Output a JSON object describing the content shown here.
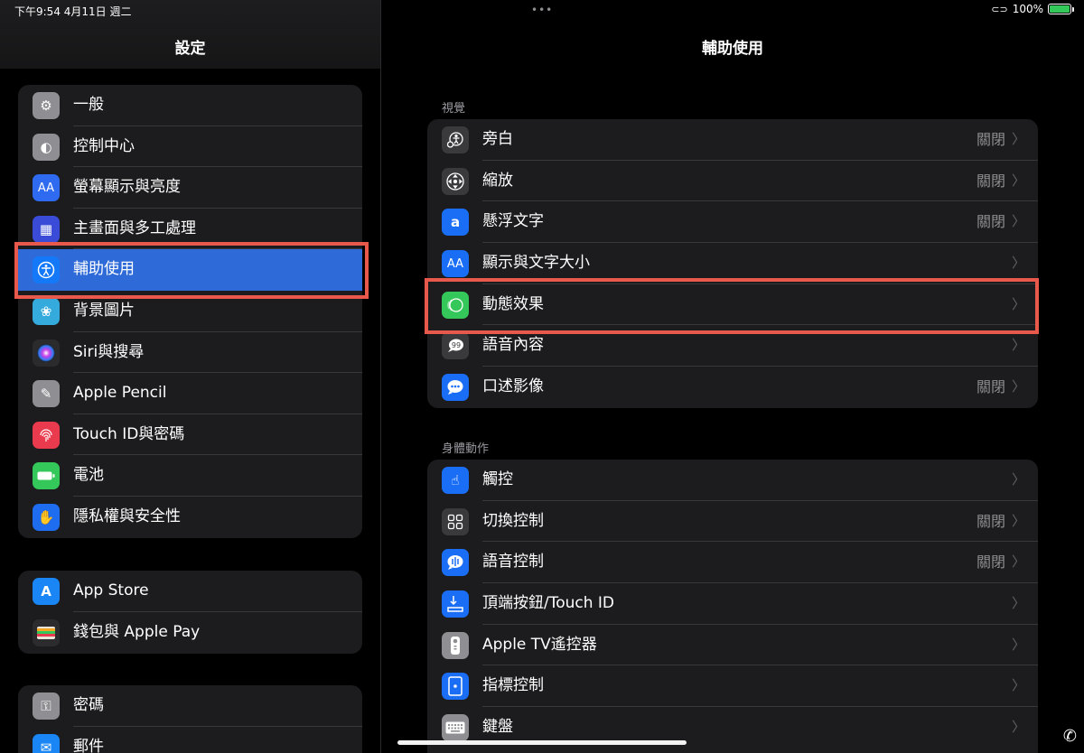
{
  "status": {
    "time_date": "下午9:54   4月11日 週二",
    "battery": "100%",
    "battery_level": 1.0
  },
  "sidebar": {
    "title": "設定",
    "groups": [
      {
        "items": [
          {
            "label": "一般",
            "icon": "gear-icon",
            "color": "#8e8e93"
          },
          {
            "label": "控制中心",
            "icon": "toggles-icon",
            "color": "#8e8e93"
          },
          {
            "label": "螢幕顯示與亮度",
            "icon": "text-size-icon",
            "color": "#2f6bf0"
          },
          {
            "label": "主畫面與多工處理",
            "icon": "home-grid-icon",
            "color": "#3a4bd8"
          },
          {
            "label": "輔助使用",
            "icon": "accessibility-icon",
            "color": "#1479f8",
            "selected": true
          },
          {
            "label": "背景圖片",
            "icon": "flower-icon",
            "color": "#35aadc"
          },
          {
            "label": "Siri與搜尋",
            "icon": "siri-icon",
            "color": "#2b2b2e"
          },
          {
            "label": "Apple Pencil",
            "icon": "pencil-icon",
            "color": "#8e8e93"
          },
          {
            "label": "Touch ID與密碼",
            "icon": "fingerprint-icon",
            "color": "#ea3a4d"
          },
          {
            "label": "電池",
            "icon": "battery-icon",
            "color": "#34c759"
          },
          {
            "label": "隱私權與安全性",
            "icon": "hand-icon",
            "color": "#1e6cf0"
          }
        ]
      },
      {
        "items": [
          {
            "label": "App Store",
            "icon": "app-store-icon",
            "color": "#1a86f5"
          },
          {
            "label": "錢包與 Apple Pay",
            "icon": "wallet-icon",
            "color": "#2c2c2e"
          }
        ]
      },
      {
        "items": [
          {
            "label": "密碼",
            "icon": "key-icon",
            "color": "#8e8e93"
          },
          {
            "label": "郵件",
            "icon": "mail-icon",
            "color": "#1a86f5"
          }
        ]
      }
    ]
  },
  "main": {
    "title": "輔助使用",
    "sections": [
      {
        "header": "視覺",
        "rows": [
          {
            "label": "旁白",
            "value": "關閉",
            "icon": "voiceover-icon",
            "color": "#3a3a3c"
          },
          {
            "label": "縮放",
            "value": "關閉",
            "icon": "zoom-icon",
            "color": "#3a3a3c"
          },
          {
            "label": "懸浮文字",
            "value": "關閉",
            "icon": "hover-text-icon",
            "color": "#1a6ef5"
          },
          {
            "label": "顯示與文字大小",
            "value": "",
            "icon": "text-size-icon",
            "color": "#1a6ef5"
          },
          {
            "label": "動態效果",
            "value": "",
            "icon": "motion-icon",
            "color": "#34c759"
          },
          {
            "label": "語音內容",
            "value": "",
            "icon": "spoken-content-icon",
            "color": "#3a3a3c"
          },
          {
            "label": "口述影像",
            "value": "關閉",
            "icon": "audio-description-icon",
            "color": "#1a6ef5"
          }
        ]
      },
      {
        "header": "身體動作",
        "rows": [
          {
            "label": "觸控",
            "value": "",
            "icon": "touch-icon",
            "color": "#1a6ef5"
          },
          {
            "label": "切換控制",
            "value": "關閉",
            "icon": "switch-control-icon",
            "color": "#3a3a3c"
          },
          {
            "label": "語音控制",
            "value": "關閉",
            "icon": "voice-control-icon",
            "color": "#1a6ef5"
          },
          {
            "label": "頂端按鈕/Touch ID",
            "value": "",
            "icon": "top-button-icon",
            "color": "#1a6ef5"
          },
          {
            "label": "Apple TV遙控器",
            "value": "",
            "icon": "remote-icon",
            "color": "#8e8e93"
          },
          {
            "label": "指標控制",
            "value": "",
            "icon": "pointer-icon",
            "color": "#1a6ef5"
          },
          {
            "label": "鍵盤",
            "value": "",
            "icon": "keyboard-icon",
            "color": "#8e8e93"
          }
        ]
      }
    ]
  },
  "accent_color": "#2f6bd8",
  "highlight_color": "#e8584b"
}
